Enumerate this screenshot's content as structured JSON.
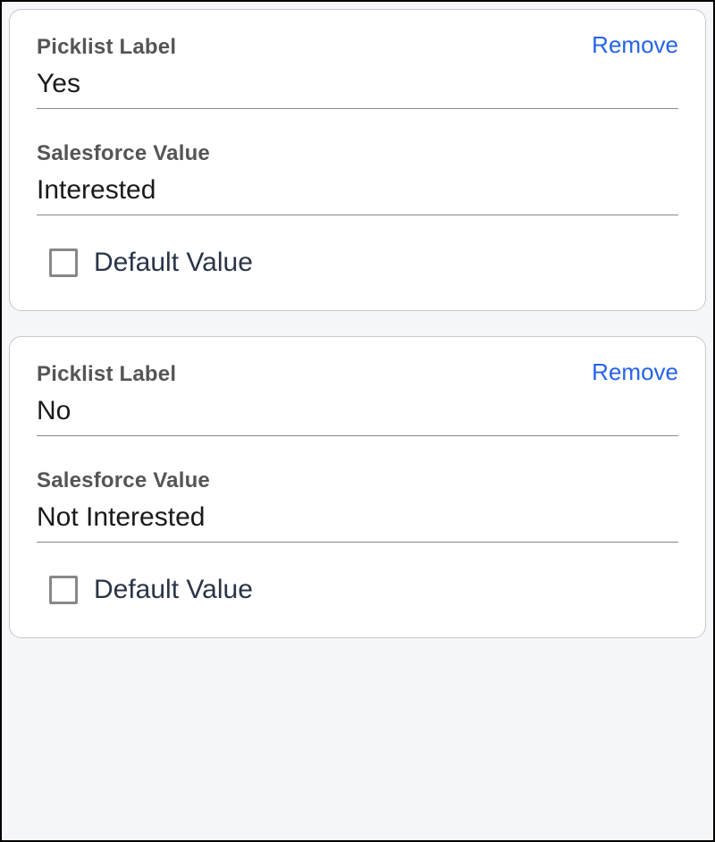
{
  "labels": {
    "picklist_label": "Picklist Label",
    "salesforce_value": "Salesforce Value",
    "default_value": "Default Value",
    "remove": "Remove"
  },
  "items": [
    {
      "picklist_value": "Yes",
      "salesforce_value": "Interested",
      "default_checked": false
    },
    {
      "picklist_value": "No",
      "salesforce_value": "Not Interested",
      "default_checked": false
    }
  ]
}
